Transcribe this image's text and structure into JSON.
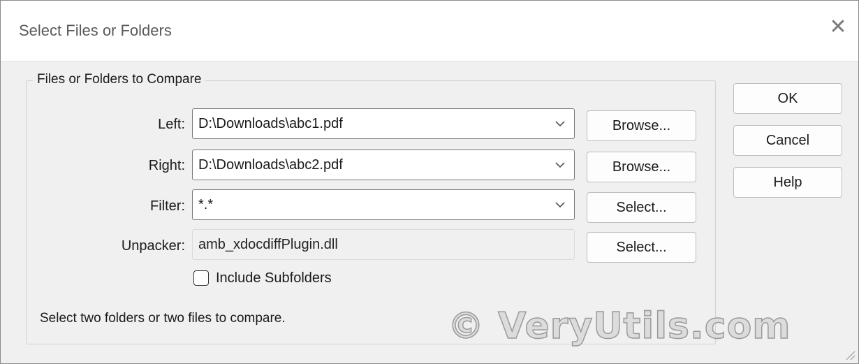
{
  "window": {
    "title": "Select Files or Folders"
  },
  "group": {
    "legend": "Files or Folders to Compare",
    "left": {
      "label": "Left:",
      "value": "D:\\Downloads\\abc1.pdf",
      "button": "Browse..."
    },
    "right": {
      "label": "Right:",
      "value": "D:\\Downloads\\abc2.pdf",
      "button": "Browse..."
    },
    "filter": {
      "label": "Filter:",
      "value": "*.*",
      "button": "Select..."
    },
    "unpacker": {
      "label": "Unpacker:",
      "value": "amb_xdocdiffPlugin.dll",
      "button": "Select..."
    },
    "include_subfolders": {
      "label": "Include Subfolders",
      "checked": false
    },
    "status": "Select two folders or two files to compare."
  },
  "buttons": {
    "ok": "OK",
    "cancel": "Cancel",
    "help": "Help"
  },
  "watermark": "© VeryUtils.com",
  "icons": {
    "close": "close-icon",
    "dropdown": "chevron-down-icon",
    "resize": "resize-grip-icon"
  }
}
